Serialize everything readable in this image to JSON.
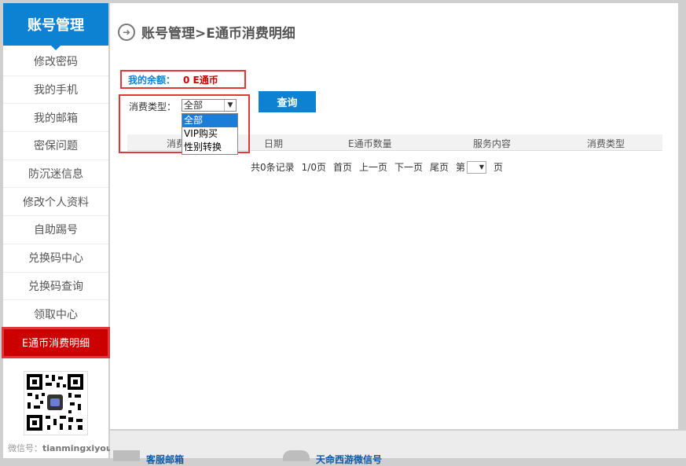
{
  "sidebar": {
    "title": "账号管理",
    "items": [
      {
        "label": "修改密码"
      },
      {
        "label": "我的手机"
      },
      {
        "label": "我的邮箱"
      },
      {
        "label": "密保问题"
      },
      {
        "label": "防沉迷信息"
      },
      {
        "label": "修改个人资料"
      },
      {
        "label": "自助踢号"
      },
      {
        "label": "兑换码中心"
      },
      {
        "label": "兑换码查询"
      },
      {
        "label": "领取中心"
      },
      {
        "label": "E通币消费明细"
      }
    ],
    "active_index": 10,
    "qr_label": "微信号：",
    "qr_account": "tianmingxiyou"
  },
  "main": {
    "title": "账号管理>E通币消费明细",
    "balance_label": "我的余额：",
    "balance_value": "0 E通币",
    "filter_label": "消费类型：",
    "filter_selected": "全部",
    "filter_options": [
      "全部",
      "VIP购买",
      "性别转换"
    ],
    "query_button": "查询",
    "columns": [
      "消费",
      "日期",
      "E通币数量",
      "服务内容",
      "消费类型"
    ],
    "pager": {
      "summary": "共0条记录",
      "page_info": "1/0页",
      "first": "首页",
      "prev": "上一页",
      "next": "下一页",
      "last": "尾页",
      "goto_prefix": "第",
      "goto_suffix": "页"
    }
  },
  "footer": {
    "link1": "客服邮箱",
    "link2": "天命西游微信号"
  },
  "colors": {
    "accent": "#0e82d2",
    "active": "#cc0000",
    "highlight_border": "#e2373a"
  }
}
